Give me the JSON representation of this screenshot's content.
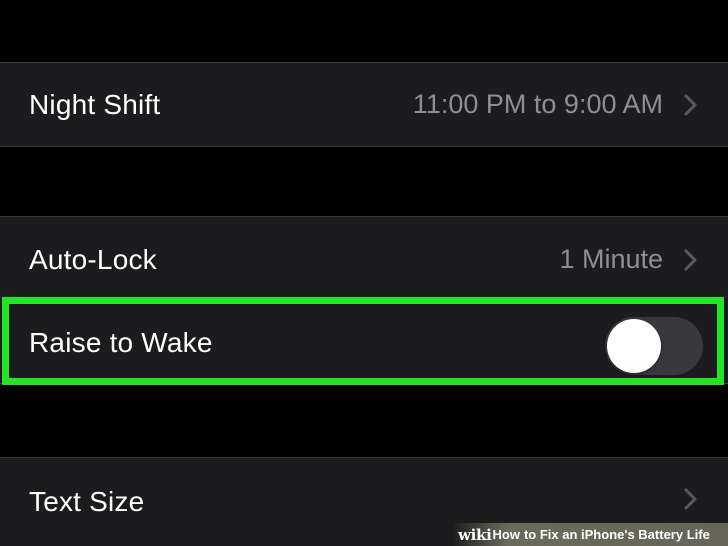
{
  "settings": {
    "night_shift": {
      "label": "Night Shift",
      "value": "11:00 PM to 9:00 AM",
      "icon": "chevron-right-icon"
    },
    "auto_lock": {
      "label": "Auto-Lock",
      "value": "1 Minute",
      "icon": "chevron-right-icon"
    },
    "raise_to_wake": {
      "label": "Raise to Wake",
      "toggle_state": "off",
      "highlight_color": "#22e524"
    },
    "text_size": {
      "label": "Text Size",
      "icon": "chevron-right-icon"
    }
  },
  "watermark": {
    "brand_bold": "wiki",
    "brand_light": "",
    "how": "How",
    "title": "to Fix an iPhone's Battery Life"
  },
  "colors": {
    "background": "#000000",
    "row_background": "#1c1c1e",
    "label": "#ffffff",
    "value": "#8e8e93",
    "toggle_off": "#39393d",
    "highlight": "#22e524"
  }
}
